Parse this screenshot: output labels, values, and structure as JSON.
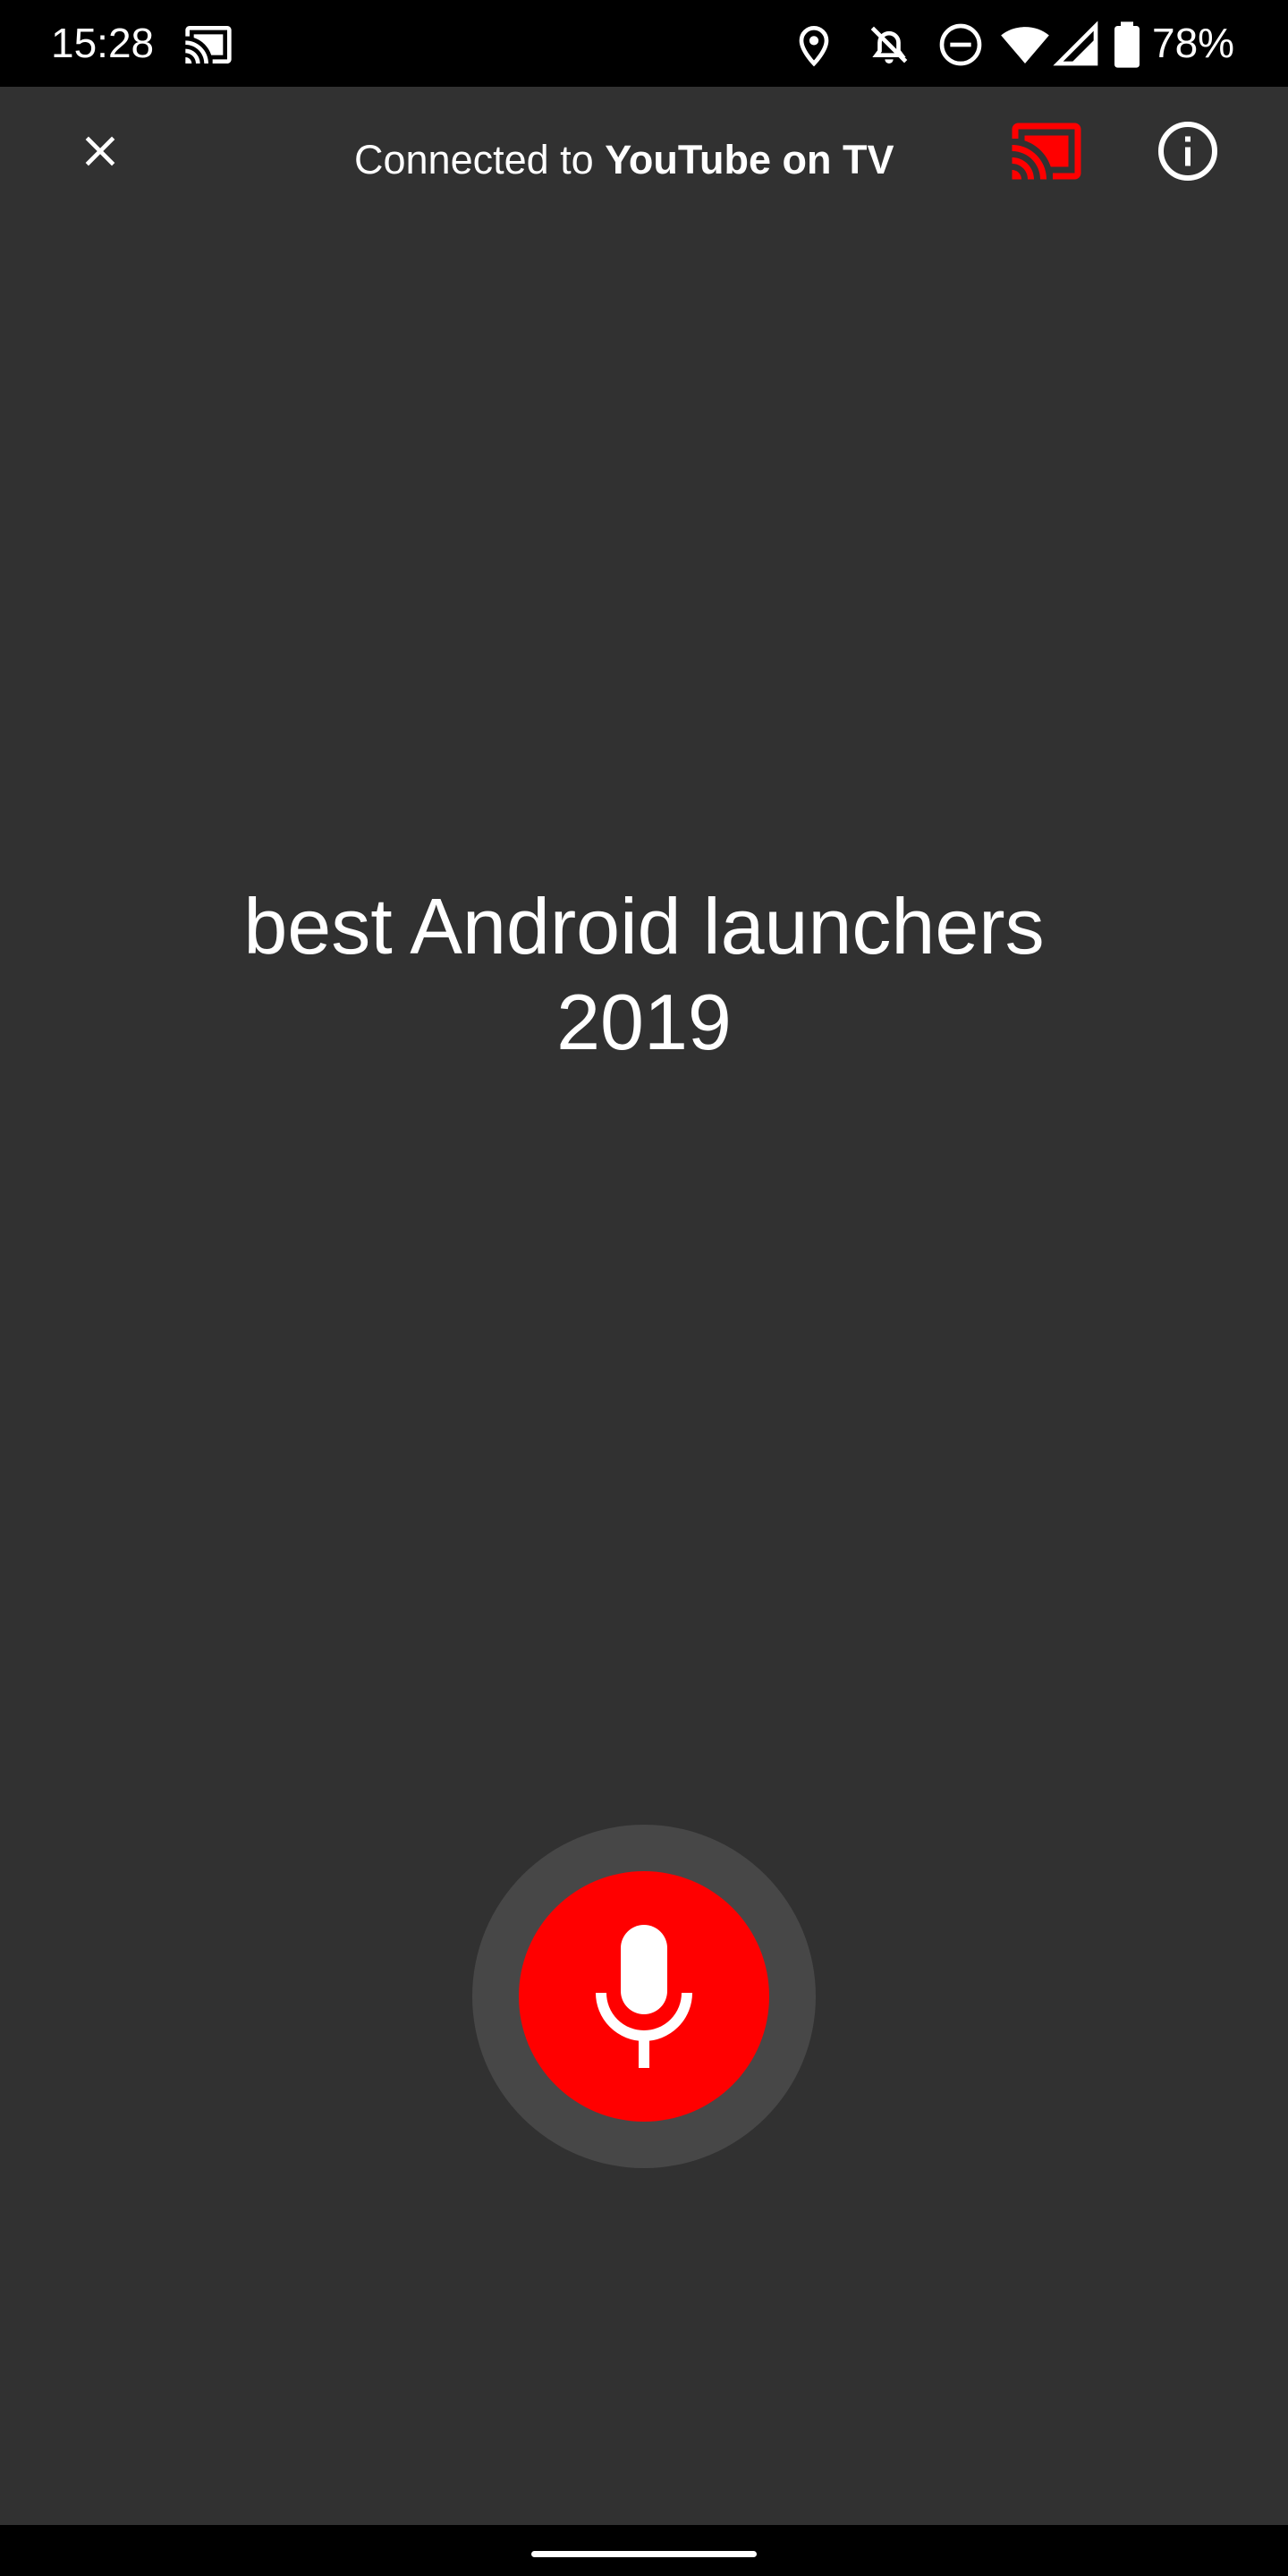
{
  "status_bar": {
    "time": "15:28",
    "battery_percent": "78%",
    "icons": [
      "cast-icon",
      "location-icon",
      "notifications-off-icon",
      "do-not-disturb-icon",
      "wifi-icon",
      "signal-icon",
      "battery-icon"
    ]
  },
  "top_bar": {
    "connected_prefix": "Connected to ",
    "device_name": "YouTube on TV",
    "close_icon": "close-icon",
    "cast_icon": "cast-connected-icon",
    "info_icon": "info-icon"
  },
  "voice_search": {
    "query_line1": "best Android launchers",
    "query_line2": "2019",
    "mic_icon": "microphone-icon"
  },
  "colors": {
    "background": "#313131",
    "accent": "#ff0000",
    "mic_ring": "#474747",
    "text": "#ffffff"
  }
}
